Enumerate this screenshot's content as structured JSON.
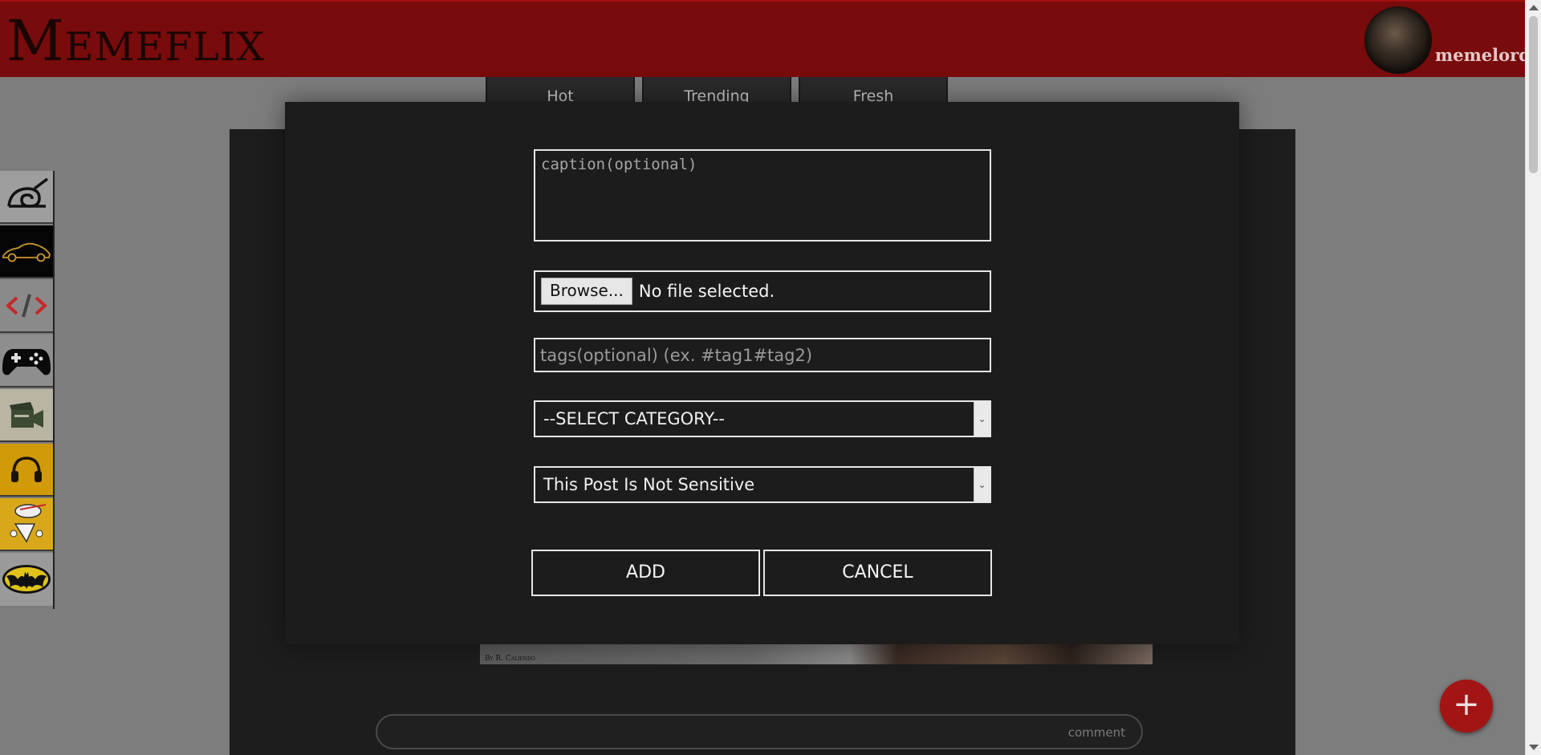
{
  "header": {
    "logo": "Memeflix",
    "username": "memelord"
  },
  "tabs": [
    {
      "label": "Hot"
    },
    {
      "label": "Trending"
    },
    {
      "label": "Fresh"
    }
  ],
  "sidebar": {
    "categories": [
      {
        "icon": "leaf-village-icon"
      },
      {
        "icon": "sports-car-icon"
      },
      {
        "icon": "code-icon"
      },
      {
        "icon": "gamepad-icon"
      },
      {
        "icon": "clapperboard-icon"
      },
      {
        "icon": "headphones-icon"
      },
      {
        "icon": "cartoon-character-icon"
      },
      {
        "icon": "batman-icon"
      }
    ]
  },
  "feed": {
    "meme_credit": "By R. Caliendo",
    "comment_placeholder": "comment"
  },
  "modal": {
    "caption_placeholder": "caption(optional)",
    "browse_label": "Browse...",
    "file_status": "No file selected.",
    "tags_placeholder": "tags(optional) (ex. #tag1#tag2)",
    "category_selected": "--SELECT CATEGORY--",
    "sensitivity_selected": "This Post Is Not Sensitive",
    "add_label": "ADD",
    "cancel_label": "CANCEL"
  },
  "fab": {
    "label": "+"
  },
  "colors": {
    "header": "#780b0b",
    "modal_bg": "#1c1c1c",
    "fab": "#a31414"
  }
}
